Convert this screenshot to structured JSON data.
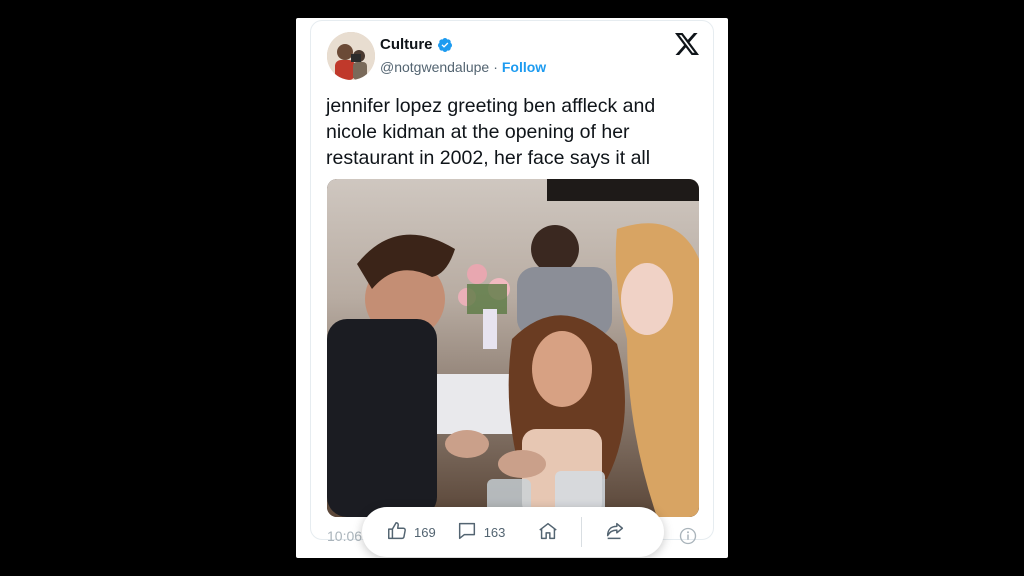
{
  "author": {
    "display_name": "Culture",
    "handle": "@notgwendalupe",
    "separator": "·",
    "follow_label": "Follow",
    "verified_color": "#1d9bf0"
  },
  "tweet": {
    "text": "jennifer lopez greeting ben affleck and nicole kidman at the opening of her restaurant in 2002, her face says it all",
    "timestamp": "10:06"
  },
  "actions": {
    "likes": "169",
    "replies": "163"
  },
  "icons": {
    "brand": "x-logo-icon",
    "verified": "verified-badge-icon",
    "like": "thumbs-up-icon",
    "reply": "comment-icon",
    "home": "home-icon",
    "share": "share-icon",
    "info": "info-icon"
  },
  "colors": {
    "accent": "#1d9bf0",
    "text": "#0f1419",
    "muted": "#536471",
    "background": "#000000"
  }
}
